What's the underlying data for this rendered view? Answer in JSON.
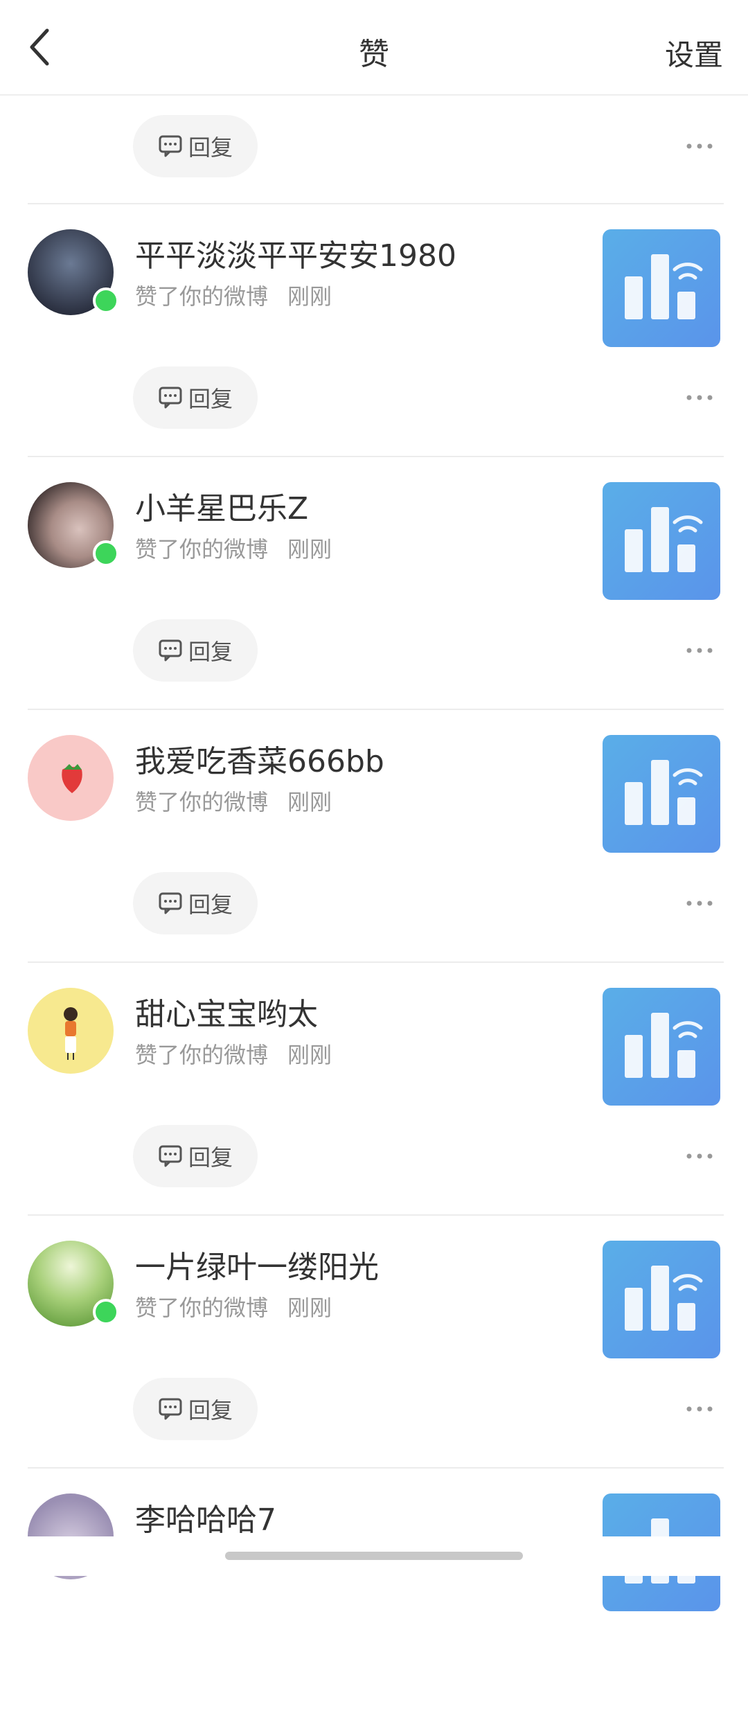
{
  "header": {
    "title": "赞",
    "settings_label": "设置"
  },
  "reply_label": "回复",
  "items": [
    {
      "name": "平平淡淡平平安安1980",
      "action": "赞了你的微博",
      "time": "刚刚",
      "online": true,
      "avatar_colors": [
        "#2a2f3f",
        "#6b7a94"
      ]
    },
    {
      "name": "小羊星巴乐Z",
      "action": "赞了你的微博",
      "time": "刚刚",
      "online": true,
      "avatar_colors": [
        "#3a2f2f",
        "#d9c2bd"
      ]
    },
    {
      "name": "我爱吃香菜666bb",
      "action": "赞了你的微博",
      "time": "刚刚",
      "online": false,
      "avatar_colors": [
        "#f6b3b3",
        "#f9c9c7"
      ]
    },
    {
      "name": "甜心宝宝哟太",
      "action": "赞了你的微博",
      "time": "刚刚",
      "online": false,
      "avatar_colors": [
        "#f8eaa0",
        "#f7e68e"
      ]
    },
    {
      "name": "一片绿叶一缕阳光",
      "action": "赞了你的微博",
      "time": "刚刚",
      "online": true,
      "avatar_colors": [
        "#7dbd4d",
        "#cfe8a0"
      ]
    },
    {
      "name": "李哈哈哈7",
      "action": "",
      "time": "",
      "online": false,
      "avatar_colors": [
        "#9a8fb3",
        "#d6cde0"
      ]
    }
  ],
  "icons": {
    "back": "chevron-left-icon",
    "reply": "comment-icon",
    "more": "more-horizontal-icon",
    "thumb": "bar-chart-wifi-icon"
  },
  "colors": {
    "online": "#3dd55a",
    "thumb_start": "#5aaee8",
    "thumb_end": "#5a94ea"
  }
}
